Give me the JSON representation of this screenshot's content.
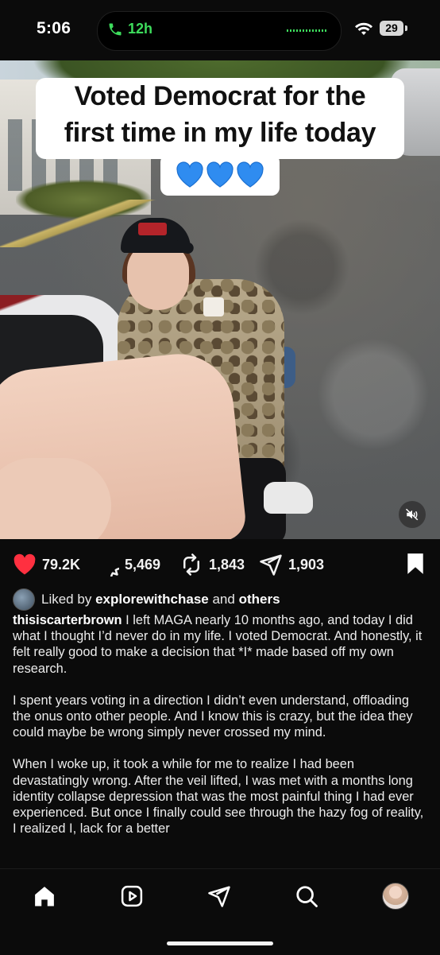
{
  "status_bar": {
    "time": "5:06",
    "call_timer": "12h",
    "battery": "29",
    "icons": [
      "phone-icon",
      "wifi-icon",
      "battery-icon"
    ],
    "accent_green": "#3ddc5c"
  },
  "post": {
    "image_caption_lines": [
      "Voted Democrat for the",
      "first time in my life today"
    ],
    "image_emojis": [
      "blue-heart",
      "blue-heart",
      "blue-heart"
    ],
    "actions": {
      "likes": "79.2K",
      "comments": "5,469",
      "reposts": "1,843",
      "shares": "1,903"
    },
    "liked_by": {
      "prefix": "Liked by",
      "user": "explorewithchase",
      "connector": "and",
      "others": "others"
    },
    "username": "thisiscarterbrown",
    "paragraphs": [
      "I left MAGA nearly 10 months ago, and today I did what I thought I’d never do in my life. I voted Democrat. And honestly, it felt really good to make a decision that *I* made based off my own research.",
      "I spent years voting in a direction I didn’t even understand, offloading the onus onto other people. And I know this is crazy, but the idea they could maybe be wrong simply never crossed my mind.",
      "When I woke up, it took a while for me to realize I had been devastatingly wrong. After the veil lifted, I was met with a months long identity collapse depression that was the most painful thing I had ever experienced. But once I finally could see through the hazy fog of reality, I realized I, lack for a better"
    ],
    "colors": {
      "like_red": "#ff3040",
      "text": "#ececec"
    }
  },
  "bottom_nav": {
    "items": [
      "home-icon",
      "reels-icon",
      "send-icon",
      "search-icon",
      "profile-avatar"
    ]
  }
}
